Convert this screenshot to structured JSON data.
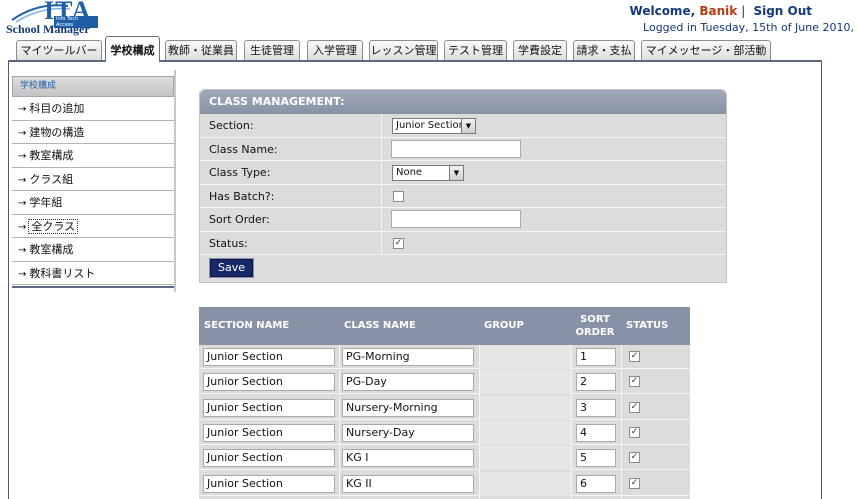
{
  "header": {
    "logo_text": "ITA",
    "logo_sub": "Info Tech Access",
    "app_name": "School Manager",
    "welcome_prefix": "Welcome,",
    "username": "Banik",
    "separator": "|",
    "signout_label": "Sign Out",
    "logged_in": "Logged in Tuesday, 15th of June 2010,"
  },
  "tabs": [
    {
      "label": "マイツールバー"
    },
    {
      "label": "学校構成"
    },
    {
      "label": "教師・従業員"
    },
    {
      "label": "生徒管理"
    },
    {
      "label": "入学管理"
    },
    {
      "label": "レッスン管理"
    },
    {
      "label": "テスト管理"
    },
    {
      "label": "学費設定"
    },
    {
      "label": "請求・支払"
    },
    {
      "label": "マイメッセージ・部活動"
    }
  ],
  "active_tab": "学校構成",
  "sidebar": {
    "heading": "学校構成",
    "arrow": "→",
    "items": [
      {
        "label": "科目の追加"
      },
      {
        "label": "建物の構造"
      },
      {
        "label": "教室構成"
      },
      {
        "label": "クラス組"
      },
      {
        "label": "学年組"
      },
      {
        "label": "全クラス"
      },
      {
        "label": "教室構成"
      },
      {
        "label": "教科書リスト"
      }
    ],
    "selected": "全クラス"
  },
  "form": {
    "title": "CLASS MANAGEMENT:",
    "section_label": "Section:",
    "section_value": "Junior Section",
    "class_name_label": "Class Name:",
    "class_name_value": "",
    "class_type_label": "Class Type:",
    "class_type_value": "None",
    "has_batch_label": "Has Batch?:",
    "has_batch_checked": false,
    "sort_order_label": "Sort Order:",
    "sort_order_value": "",
    "status_label": "Status:",
    "status_checked": true,
    "save_label": "Save"
  },
  "table": {
    "columns": {
      "section": "SECTION NAME",
      "class": "CLASS NAME",
      "group": "GROUP",
      "sort_line1": "SORT",
      "sort_line2": "ORDER",
      "status": "STATUS"
    },
    "rows": [
      {
        "section": "Junior Section",
        "class": "PG-Morning",
        "group": "",
        "sort": "1",
        "status": true
      },
      {
        "section": "Junior Section",
        "class": "PG-Day",
        "group": "",
        "sort": "2",
        "status": true
      },
      {
        "section": "Junior Section",
        "class": "Nursery-Morning",
        "group": "",
        "sort": "3",
        "status": true
      },
      {
        "section": "Junior Section",
        "class": "Nursery-Day",
        "group": "",
        "sort": "4",
        "status": true
      },
      {
        "section": "Junior Section",
        "class": "KG I",
        "group": "",
        "sort": "5",
        "status": true
      },
      {
        "section": "Junior Section",
        "class": "KG II",
        "group": "",
        "sort": "6",
        "status": true
      }
    ]
  },
  "colors": {
    "brand_blue": "#1f5fa8",
    "header_navy": "#123a7a",
    "username_red": "#b13b14",
    "panel_header": "#8792a6",
    "save_button": "#19286b"
  }
}
